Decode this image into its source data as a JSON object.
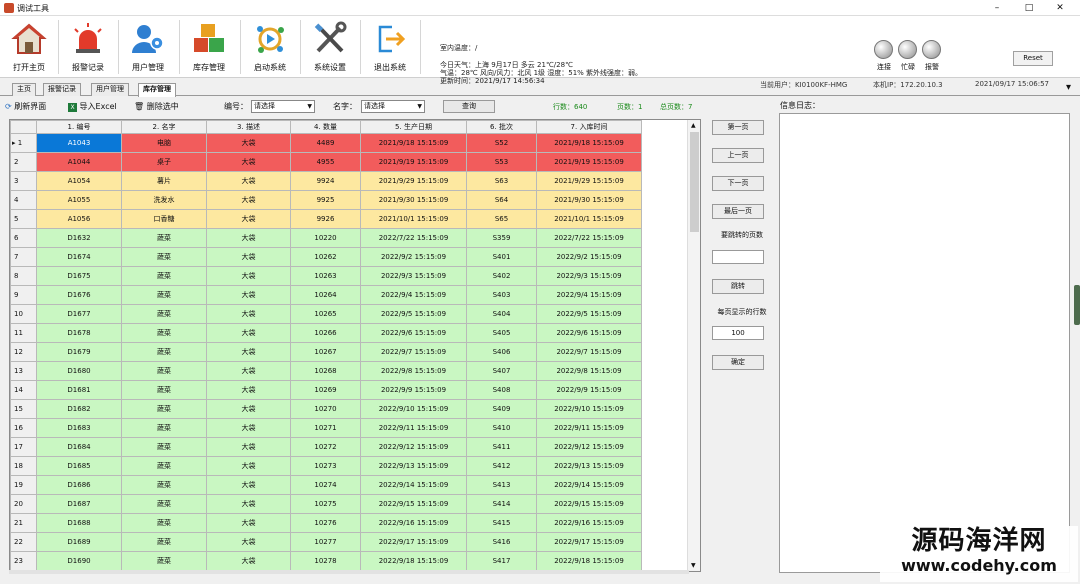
{
  "window": {
    "title": "调试工具"
  },
  "toolbar": [
    {
      "name": "open-home-button",
      "label": "打开主页",
      "icon": "home-icon"
    },
    {
      "name": "alarm-log-button",
      "label": "报警记录",
      "icon": "siren-icon"
    },
    {
      "name": "user-manage-button",
      "label": "用户管理",
      "icon": "users-icon"
    },
    {
      "name": "inventory-manage-button",
      "label": "库存管理",
      "icon": "boxes-icon"
    },
    {
      "name": "start-system-button",
      "label": "启动系统",
      "icon": "start-icon"
    },
    {
      "name": "system-settings-button",
      "label": "系统设置",
      "icon": "tools-icon"
    },
    {
      "name": "exit-system-button",
      "label": "退出系统",
      "icon": "exit-icon"
    }
  ],
  "info": {
    "indoor_temp": "室内温度：/",
    "weather_line1": "今日天气：上海 9月17日 多云 21℃/28℃",
    "weather_line2": "气温：28℃ 风向/风力：北风 1级 湿度：51% 紫外线强度：弱。",
    "update_time": "更新时间：2021/9/17 14:56:34"
  },
  "leds": [
    {
      "label": "连接"
    },
    {
      "label": "忙碌"
    },
    {
      "label": "报警"
    }
  ],
  "reset_label": "Reset",
  "status": {
    "current_user": "当前用户：KI0100KF-HMG",
    "local_ip": "本机IP：172.20.10.3",
    "datetime": "2021/09/17 15:06:57"
  },
  "tabs": [
    {
      "label": "主页",
      "active": false
    },
    {
      "label": "报警记录",
      "active": false
    },
    {
      "label": "用户管理",
      "active": false
    },
    {
      "label": "库存管理",
      "active": true
    }
  ],
  "filter": {
    "refresh_label": "刷新界面",
    "export_label": "导入Excel",
    "delete_label": "删除选中",
    "code_label": "编号：",
    "code_value": "请选择",
    "name_label": "名字：",
    "name_value": "请选择",
    "query_label": "查询",
    "rows_count": "行数：640",
    "page_num": "页数：1",
    "total_pages": "总页数：7"
  },
  "table": {
    "headers": [
      "1. 编号",
      "2. 名字",
      "3. 描述",
      "4. 数量",
      "5. 生产日期",
      "6. 批次",
      "7. 入库时间"
    ],
    "rows": [
      {
        "n": "1",
        "color": "red",
        "cells": [
          "A1043",
          "电脑",
          "大袋",
          "4489",
          "2021/9/18 15:15:09",
          "S52",
          "2021/9/18 15:15:09"
        ]
      },
      {
        "n": "2",
        "color": "red",
        "cells": [
          "A1044",
          "桌子",
          "大袋",
          "4955",
          "2021/9/19 15:15:09",
          "S53",
          "2021/9/19 15:15:09"
        ]
      },
      {
        "n": "3",
        "color": "yellow",
        "cells": [
          "A1054",
          "薯片",
          "大袋",
          "9924",
          "2021/9/29 15:15:09",
          "S63",
          "2021/9/29 15:15:09"
        ]
      },
      {
        "n": "4",
        "color": "yellow",
        "cells": [
          "A1055",
          "洗发水",
          "大袋",
          "9925",
          "2021/9/30 15:15:09",
          "S64",
          "2021/9/30 15:15:09"
        ]
      },
      {
        "n": "5",
        "color": "yellow",
        "cells": [
          "A1056",
          "口香糖",
          "大袋",
          "9926",
          "2021/10/1 15:15:09",
          "S65",
          "2021/10/1 15:15:09"
        ]
      },
      {
        "n": "6",
        "color": "green",
        "cells": [
          "D1632",
          "蔬菜",
          "大袋",
          "10220",
          "2022/7/22 15:15:09",
          "S359",
          "2022/7/22 15:15:09"
        ]
      },
      {
        "n": "7",
        "color": "green",
        "cells": [
          "D1674",
          "蔬菜",
          "大袋",
          "10262",
          "2022/9/2 15:15:09",
          "S401",
          "2022/9/2 15:15:09"
        ]
      },
      {
        "n": "8",
        "color": "green",
        "cells": [
          "D1675",
          "蔬菜",
          "大袋",
          "10263",
          "2022/9/3 15:15:09",
          "S402",
          "2022/9/3 15:15:09"
        ]
      },
      {
        "n": "9",
        "color": "green",
        "cells": [
          "D1676",
          "蔬菜",
          "大袋",
          "10264",
          "2022/9/4 15:15:09",
          "S403",
          "2022/9/4 15:15:09"
        ]
      },
      {
        "n": "10",
        "color": "green",
        "cells": [
          "D1677",
          "蔬菜",
          "大袋",
          "10265",
          "2022/9/5 15:15:09",
          "S404",
          "2022/9/5 15:15:09"
        ]
      },
      {
        "n": "11",
        "color": "green",
        "cells": [
          "D1678",
          "蔬菜",
          "大袋",
          "10266",
          "2022/9/6 15:15:09",
          "S405",
          "2022/9/6 15:15:09"
        ]
      },
      {
        "n": "12",
        "color": "green",
        "cells": [
          "D1679",
          "蔬菜",
          "大袋",
          "10267",
          "2022/9/7 15:15:09",
          "S406",
          "2022/9/7 15:15:09"
        ]
      },
      {
        "n": "13",
        "color": "green",
        "cells": [
          "D1680",
          "蔬菜",
          "大袋",
          "10268",
          "2022/9/8 15:15:09",
          "S407",
          "2022/9/8 15:15:09"
        ]
      },
      {
        "n": "14",
        "color": "green",
        "cells": [
          "D1681",
          "蔬菜",
          "大袋",
          "10269",
          "2022/9/9 15:15:09",
          "S408",
          "2022/9/9 15:15:09"
        ]
      },
      {
        "n": "15",
        "color": "green",
        "cells": [
          "D1682",
          "蔬菜",
          "大袋",
          "10270",
          "2022/9/10 15:15:09",
          "S409",
          "2022/9/10 15:15:09"
        ]
      },
      {
        "n": "16",
        "color": "green",
        "cells": [
          "D1683",
          "蔬菜",
          "大袋",
          "10271",
          "2022/9/11 15:15:09",
          "S410",
          "2022/9/11 15:15:09"
        ]
      },
      {
        "n": "17",
        "color": "green",
        "cells": [
          "D1684",
          "蔬菜",
          "大袋",
          "10272",
          "2022/9/12 15:15:09",
          "S411",
          "2022/9/12 15:15:09"
        ]
      },
      {
        "n": "18",
        "color": "green",
        "cells": [
          "D1685",
          "蔬菜",
          "大袋",
          "10273",
          "2022/9/13 15:15:09",
          "S412",
          "2022/9/13 15:15:09"
        ]
      },
      {
        "n": "19",
        "color": "green",
        "cells": [
          "D1686",
          "蔬菜",
          "大袋",
          "10274",
          "2022/9/14 15:15:09",
          "S413",
          "2022/9/14 15:15:09"
        ]
      },
      {
        "n": "20",
        "color": "green",
        "cells": [
          "D1687",
          "蔬菜",
          "大袋",
          "10275",
          "2022/9/15 15:15:09",
          "S414",
          "2022/9/15 15:15:09"
        ]
      },
      {
        "n": "21",
        "color": "green",
        "cells": [
          "D1688",
          "蔬菜",
          "大袋",
          "10276",
          "2022/9/16 15:15:09",
          "S415",
          "2022/9/16 15:15:09"
        ]
      },
      {
        "n": "22",
        "color": "green",
        "cells": [
          "D1689",
          "蔬菜",
          "大袋",
          "10277",
          "2022/9/17 15:15:09",
          "S416",
          "2022/9/17 15:15:09"
        ]
      },
      {
        "n": "23",
        "color": "green",
        "cells": [
          "D1690",
          "蔬菜",
          "大袋",
          "10278",
          "2022/9/18 15:15:09",
          "S417",
          "2022/9/18 15:15:09"
        ]
      }
    ]
  },
  "nav": {
    "first_page": "第一页",
    "prev_page": "上一页",
    "next_page": "下一页",
    "last_page": "最后一页",
    "jump_label": "要跳转的页数",
    "jump_value": "",
    "jump_button": "跳转",
    "rows_per_page_label": "每页显示的行数",
    "rows_per_page_value": "100",
    "confirm_button": "确定"
  },
  "log": {
    "title": "信息日志："
  },
  "watermark": {
    "line1": "源码海洋网",
    "line2": "www.codehy.com"
  },
  "colors": {
    "red_row": "#f25c5c",
    "yellow_row": "#fde8a0",
    "green_row": "#c9f7c2",
    "selected": "#0a78d7"
  }
}
